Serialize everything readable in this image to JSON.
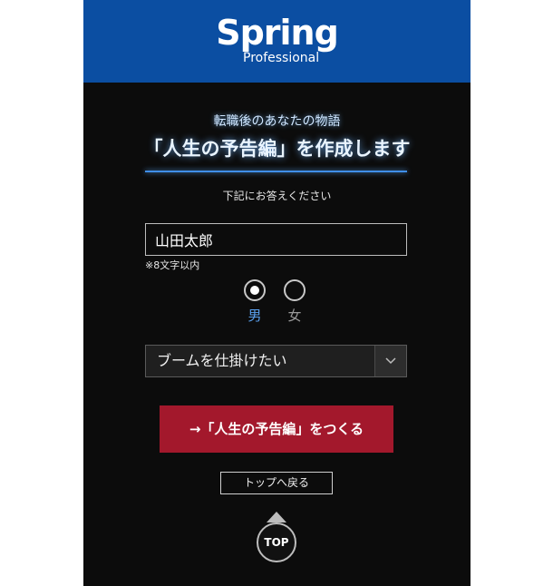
{
  "header": {
    "logo_main": "Spring",
    "logo_sub": "Professional",
    "background_color": "#0b4ea2"
  },
  "intro": {
    "subtitle": "転職後のあなたの物語",
    "title": "「人生の予告編」を作成します",
    "instruction": "下記にお答えください"
  },
  "form": {
    "name_value": "山田太郎",
    "name_note": "※8文字以内",
    "gender": {
      "options": [
        "男",
        "女"
      ],
      "selected": "男"
    },
    "goal_select": {
      "selected": "ブームを仕掛けたい",
      "arrow_icon": "chevron-down-icon"
    },
    "submit_label": "→「人生の予告編」をつくる",
    "submit_color": "#a3182c"
  },
  "nav": {
    "back_label": "トップへ戻る",
    "top_label": "TOP"
  }
}
